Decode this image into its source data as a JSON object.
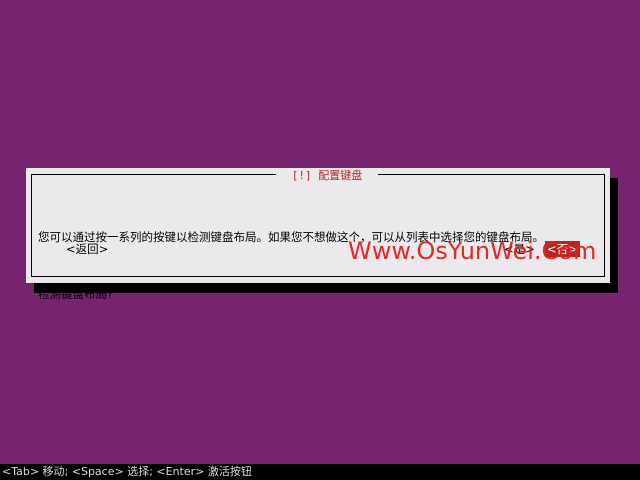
{
  "dialog": {
    "title": "[!] 配置键盘",
    "body_lines": [
      "您可以通过按一系列的按键以检测键盘布局。如果您不想做这个，可以从列表中选择您的键盘布局。",
      "检测键盘布局?"
    ],
    "buttons": {
      "back": "<返回>",
      "yes": "<是>",
      "no": "<否>"
    }
  },
  "watermark": "Www.OsYunWei.Com",
  "status_bar": "<Tab> 移动; <Space> 选择; <Enter> 激活按钮",
  "colors": {
    "background": "#76246e",
    "dialog": "#ece9ec",
    "accent": "#b5271f",
    "watermark": "#e0201f",
    "status_bar": "#000000"
  }
}
